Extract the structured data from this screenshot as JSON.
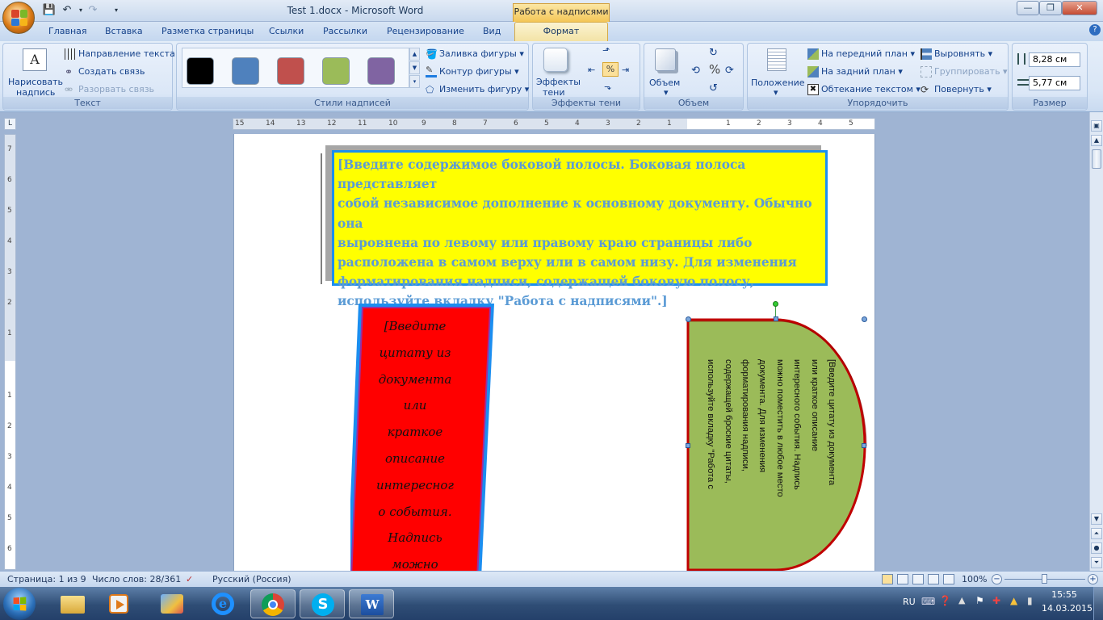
{
  "window": {
    "title": "Test 1.docx - Microsoft Word",
    "context_tab": "Работа с надписями",
    "minimize": "—",
    "maximize": "❐",
    "close": "✕",
    "help": "?"
  },
  "tabs": [
    "Главная",
    "Вставка",
    "Разметка страницы",
    "Ссылки",
    "Рассылки",
    "Рецензирование",
    "Вид"
  ],
  "active_tab": "Формат",
  "ribbon": {
    "text_group": {
      "label": "Текст",
      "draw_label_1": "Нарисовать",
      "draw_label_2": "надпись",
      "direction": "Направление текста",
      "create_link": "Создать связь",
      "break_link": "Разорвать связь"
    },
    "styles_group": {
      "label": "Стили надписей",
      "swatch_colors": [
        "#000000",
        "#4f81bd",
        "#c0504d",
        "#9bbb59",
        "#8064a2"
      ],
      "fill": "Заливка фигуры",
      "outline": "Контур фигуры",
      "change_shape": "Изменить фигуру"
    },
    "shadow_group": {
      "label": "Эффекты тени",
      "effects_1": "Эффекты",
      "effects_2": "тени"
    },
    "volume_group": {
      "label": "Объем",
      "volume": "Объем"
    },
    "arrange_group": {
      "label": "Упорядочить",
      "position": "Положение",
      "bring_front": "На передний план",
      "send_back": "На задний план",
      "wrap": "Обтекание текстом",
      "align": "Выровнять",
      "group": "Группировать",
      "rotate": "Повернуть"
    },
    "size_group": {
      "label": "Размер",
      "height": "8,28 см",
      "width": "5,77 см"
    }
  },
  "ruler": {
    "labels": [
      "15",
      "14",
      "13",
      "12",
      "11",
      "10",
      "9",
      "8",
      "7",
      "6",
      "5",
      "4",
      "3",
      "2",
      "1",
      "1",
      "2",
      "3",
      "4",
      "5"
    ],
    "vlabels": [
      "7",
      "6",
      "5",
      "4",
      "3",
      "2",
      "1",
      "1",
      "2",
      "3",
      "4",
      "5",
      "6"
    ]
  },
  "document": {
    "sidebar_text": "[Введите содержимое боковой полосы. Боковая полоса представляет собой независимое дополнение к основному документу. Обычно она выровнена по левому или правому краю страницы либо расположена в самом верху или в самом низу. Для изменения форматирования надписи, содержащей боковую полосу, используйте вкладку \"Работа с надписями\".]",
    "sidebar_lines": [
      "[Введите содержимое боковой полосы. Боковая полоса представляет",
      "собой независимое дополнение к основному документу. Обычно она",
      "выровнена по левому или правому краю страницы либо",
      "расположена в самом верху или в самом низу. Для изменения",
      "форматирования надписи, содержащей боковую полосу,",
      "используйте вкладку \"Работа с надписями\".]"
    ],
    "quote_lines": [
      "[Введите",
      "цитату из",
      "документа",
      "или",
      "краткое",
      "описание",
      "интересног",
      "о события.",
      "Надпись",
      "можно"
    ],
    "green_lines": [
      "[Введите цитату из документа",
      "или краткое описание",
      "интересного события. Надпись",
      "можно поместить в любое место",
      "документа. Для изменения",
      "форматирования надписи,",
      "содержащей броские цитаты,",
      "используйте вкладку \"Работа с"
    ],
    "colors": {
      "sidebar_fill": "#ffff00",
      "sidebar_border": "#1b8ef0",
      "sidebar_text": "#5b9bd5",
      "quote_fill": "#ff0000",
      "quote_border": "#1b8ef0",
      "green_fill": "#9bbb59",
      "green_border": "#c00000"
    }
  },
  "status": {
    "page": "Страница: 1 из 9",
    "words": "Число слов: 28/361",
    "language": "Русский (Россия)",
    "zoom": "100%"
  },
  "tray": {
    "lang": "RU",
    "time": "15:55",
    "date": "14.03.2015"
  },
  "taskbar_icons": [
    "start-orb-icon",
    "file-explorer-icon",
    "media-player-icon",
    "control-panel-icon",
    "internet-explorer-icon",
    "chrome-icon",
    "skype-icon",
    "word-icon"
  ]
}
